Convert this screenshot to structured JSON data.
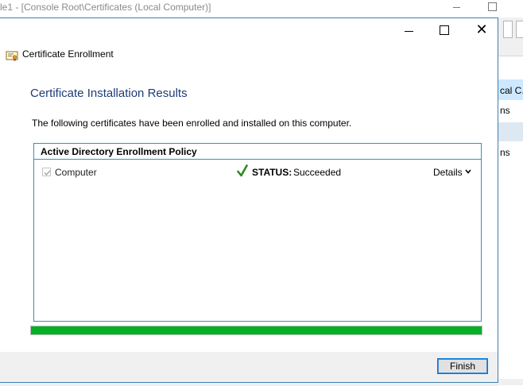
{
  "background_window": {
    "title": "le1 - [Console Root\\Certificates (Local Computer)]",
    "side_items": [
      "cal C...",
      "ns",
      "ns"
    ]
  },
  "dialog": {
    "app_name": "Certificate Enrollment",
    "heading": "Certificate Installation Results",
    "description": "The following certificates have been enrolled and installed on this computer.",
    "policy": {
      "title": "Active Directory Enrollment Policy",
      "rows": [
        {
          "name": "Computer",
          "checked": true,
          "status_label": "STATUS:",
          "status_value": "Succeeded",
          "details_label": "Details"
        }
      ]
    },
    "progress": {
      "percent": 100,
      "color": "#06b025"
    },
    "finish_label": "Finish"
  },
  "colors": {
    "heading": "#1e3c78",
    "accent_border": "#3a8fbf",
    "success_check": "#2e8b24",
    "focus_border": "#0078d7"
  },
  "icons": [
    "certificate-icon",
    "minimize-icon",
    "maximize-icon",
    "close-icon",
    "success-check-icon",
    "chevron-down-icon"
  ]
}
